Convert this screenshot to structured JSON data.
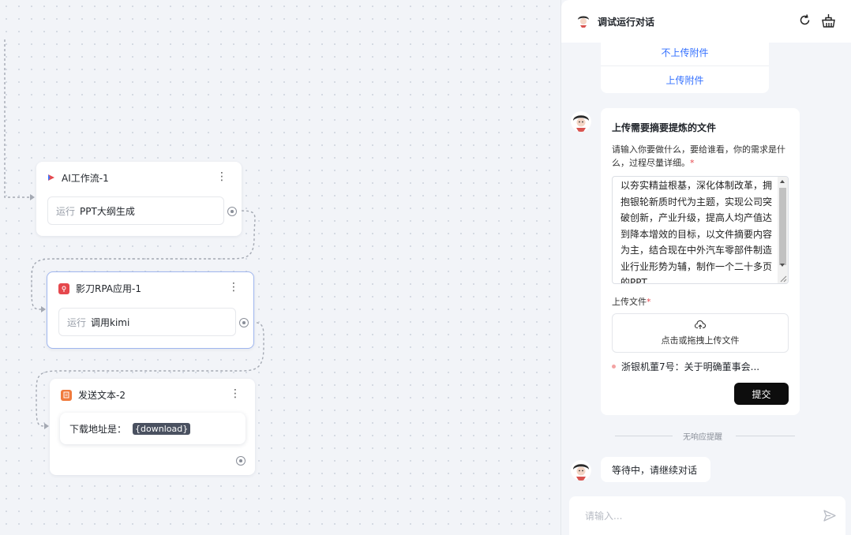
{
  "workflow": {
    "nodes": [
      {
        "title": "AI工作流-1",
        "run_label": "运行",
        "task": "PPT大纲生成"
      },
      {
        "title": "影刀RPA应用-1",
        "run_label": "运行",
        "task": "调用kimi"
      },
      {
        "title": "发送文本-2",
        "prefix": "下载地址是：",
        "variable": "{download}"
      }
    ]
  },
  "panel": {
    "title": "调试运行对话",
    "options": [
      "不上传附件",
      "上传附件"
    ],
    "form": {
      "title": "上传需要摘要提炼的文件",
      "hint": "请输入你要做什么，要给谁看，你的需求是什么，过程尽量详细。",
      "required_mark": "*",
      "text": "以夯实精益根基，深化体制改革，拥抱银轮新质时代为主题，实现公司突破创新，产业升级，提高人均产值达到降本增效的目标，以文件摘要内容为主，结合现在中外汽车零部件制造业行业形势为辅，制作一个二十多页的PPT",
      "upload_label": "上传文件",
      "upload_hint": "点击或拖拽上传文件",
      "file_name": "浙银机董7号：关于明确董事会...",
      "submit_label": "提交"
    },
    "divider_text": "无响应提醒",
    "waiting_message": "等待中，请继续对话",
    "input_placeholder": "请输入..."
  },
  "colors": {
    "accent": "#3370ff",
    "submit_bg": "#0d0d0d",
    "rpa_icon": "#e5484d",
    "text_node_icon": "#f07a3c",
    "selected_border": "#9fb6ef"
  }
}
